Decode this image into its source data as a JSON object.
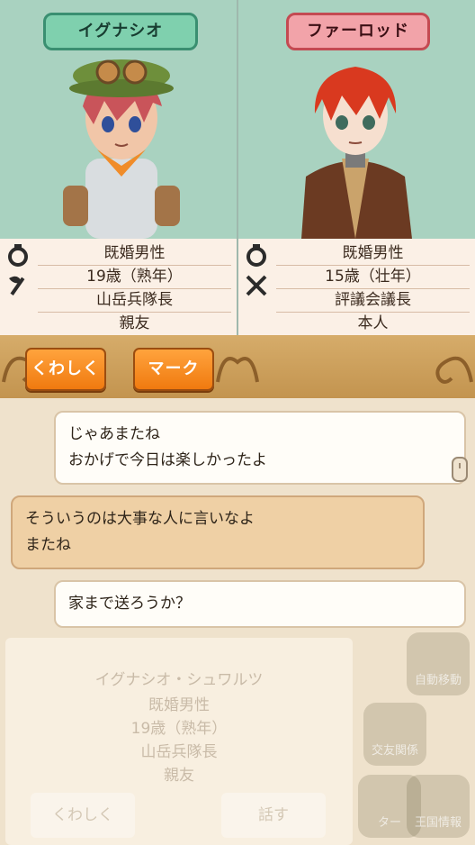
{
  "left_char": {
    "name": "イグナシオ",
    "rows": [
      "既婚男性",
      "19歳（熟年）",
      "山岳兵隊長",
      "親友"
    ]
  },
  "right_char": {
    "name": "ファーロッド",
    "rows": [
      "既婚男性",
      "15歳（壮年）",
      "評議会議長",
      "本人"
    ]
  },
  "buttons": {
    "details": "くわしく",
    "mark": "マーク"
  },
  "chat": [
    {
      "line1": "じゃあまたね",
      "line2": "おかげで今日は楽しかったよ"
    },
    {
      "line1": "そういうのは大事な人に言いなよ",
      "line2": "またね"
    },
    {
      "line1": "家まで送ろうか？"
    }
  ],
  "background_panel": {
    "name": "イグナシオ・シュワルツ",
    "rows": [
      "既婚男性",
      "19歳（熟年）",
      "山岳兵隊長",
      "親友"
    ],
    "buttons": [
      "くわしく",
      "話す"
    ],
    "menu": [
      "自動移動",
      "交友関係",
      "ター",
      "王国情報"
    ]
  },
  "colors": {
    "accent": "#f07a0f",
    "left_plate": "#7fd0ae",
    "right_plate": "#f2a3a9"
  }
}
